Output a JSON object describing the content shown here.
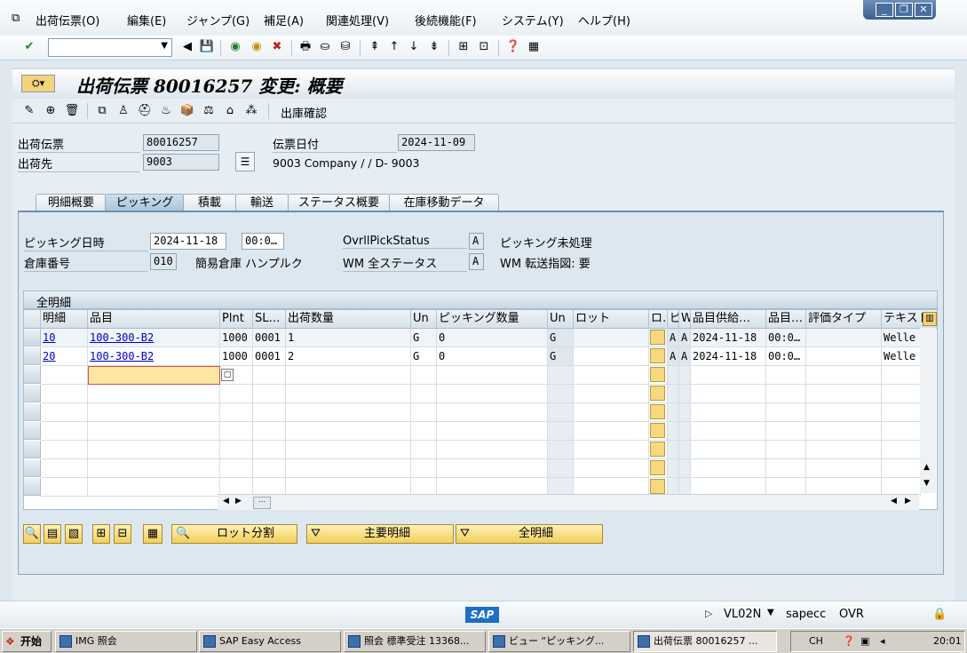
{
  "menubar": {
    "items": [
      "出荷伝票(O)",
      "編集(E)",
      "ジャンプ(G)",
      "補足(A)",
      "関連処理(V)",
      "後続機能(F)",
      "システム(Y)",
      "ヘルプ(H)"
    ]
  },
  "title": "出荷伝票 80016257 変更: 概要",
  "app_toolbar": {
    "text_button": "出庫確認"
  },
  "header": {
    "delivery_label": "出荷伝票",
    "delivery_value": "80016257",
    "shipto_label": "出荷先",
    "shipto_value": "9003",
    "shipto_desc": "9003 Company / / D- 9003",
    "docdate_label": "伝票日付",
    "docdate_value": "2024-11-09"
  },
  "tabs": [
    "明細概要",
    "ピッキング",
    "積載",
    "輸送",
    "ステータス概要",
    "在庫移動データ"
  ],
  "picking": {
    "date_label": "ピッキング日時",
    "date_value": "2024-11-18",
    "time_value": "00:0…",
    "warehouse_label": "倉庫番号",
    "warehouse_value": "010",
    "warehouse_desc": "簡易倉庫 ハンプルク",
    "overall_label": "OvrllPickStatus",
    "overall_value": "A",
    "overall_desc": "ピッキング未処理",
    "wm_label": "WM 全ステータス",
    "wm_value": "A",
    "wm_desc": "WM 転送指図: 要"
  },
  "table": {
    "title": "全明細",
    "columns": [
      "明細",
      "品目",
      "Plnt",
      "SL…",
      "出荷数量",
      "Un",
      "ピッキング数量",
      "Un",
      "ロット",
      "ロ…",
      "ピ",
      "W",
      "品目供給…",
      "品目…",
      "評価タイプ",
      "テキスト"
    ],
    "rows": [
      {
        "item": "10",
        "material": "100-300-B2",
        "plant": "1000",
        "sloc": "0001",
        "qty": "1",
        "unit": "G",
        "pick_qty": "0",
        "pick_unit": "G",
        "batch": "",
        "p": "A",
        "w": "A",
        "avail_date": "2024-11-18",
        "avail_time": "00:0…",
        "val_type": "",
        "text": "Welle"
      },
      {
        "item": "20",
        "material": "100-300-B2",
        "plant": "1000",
        "sloc": "0001",
        "qty": "2",
        "unit": "G",
        "pick_qty": "0",
        "pick_unit": "G",
        "batch": "",
        "p": "A",
        "w": "A",
        "avail_date": "2024-11-18",
        "avail_time": "00:0…",
        "val_type": "",
        "text": "Welle"
      }
    ]
  },
  "buttons": {
    "batch_split": "ロット分割",
    "main_items": "主要明細",
    "all_items": "全明細"
  },
  "statusbar": {
    "tcode": "VL02N",
    "system": "sapecc",
    "mode": "OVR",
    "logo": "SAP"
  },
  "taskbar": {
    "start": "开始",
    "tasks": [
      "IMG 照会",
      "SAP Easy Access",
      "照会 標準受注 13368...",
      "ビュー “ピッキング...",
      "出荷伝票 80016257 ..."
    ],
    "clock": "20:01"
  }
}
